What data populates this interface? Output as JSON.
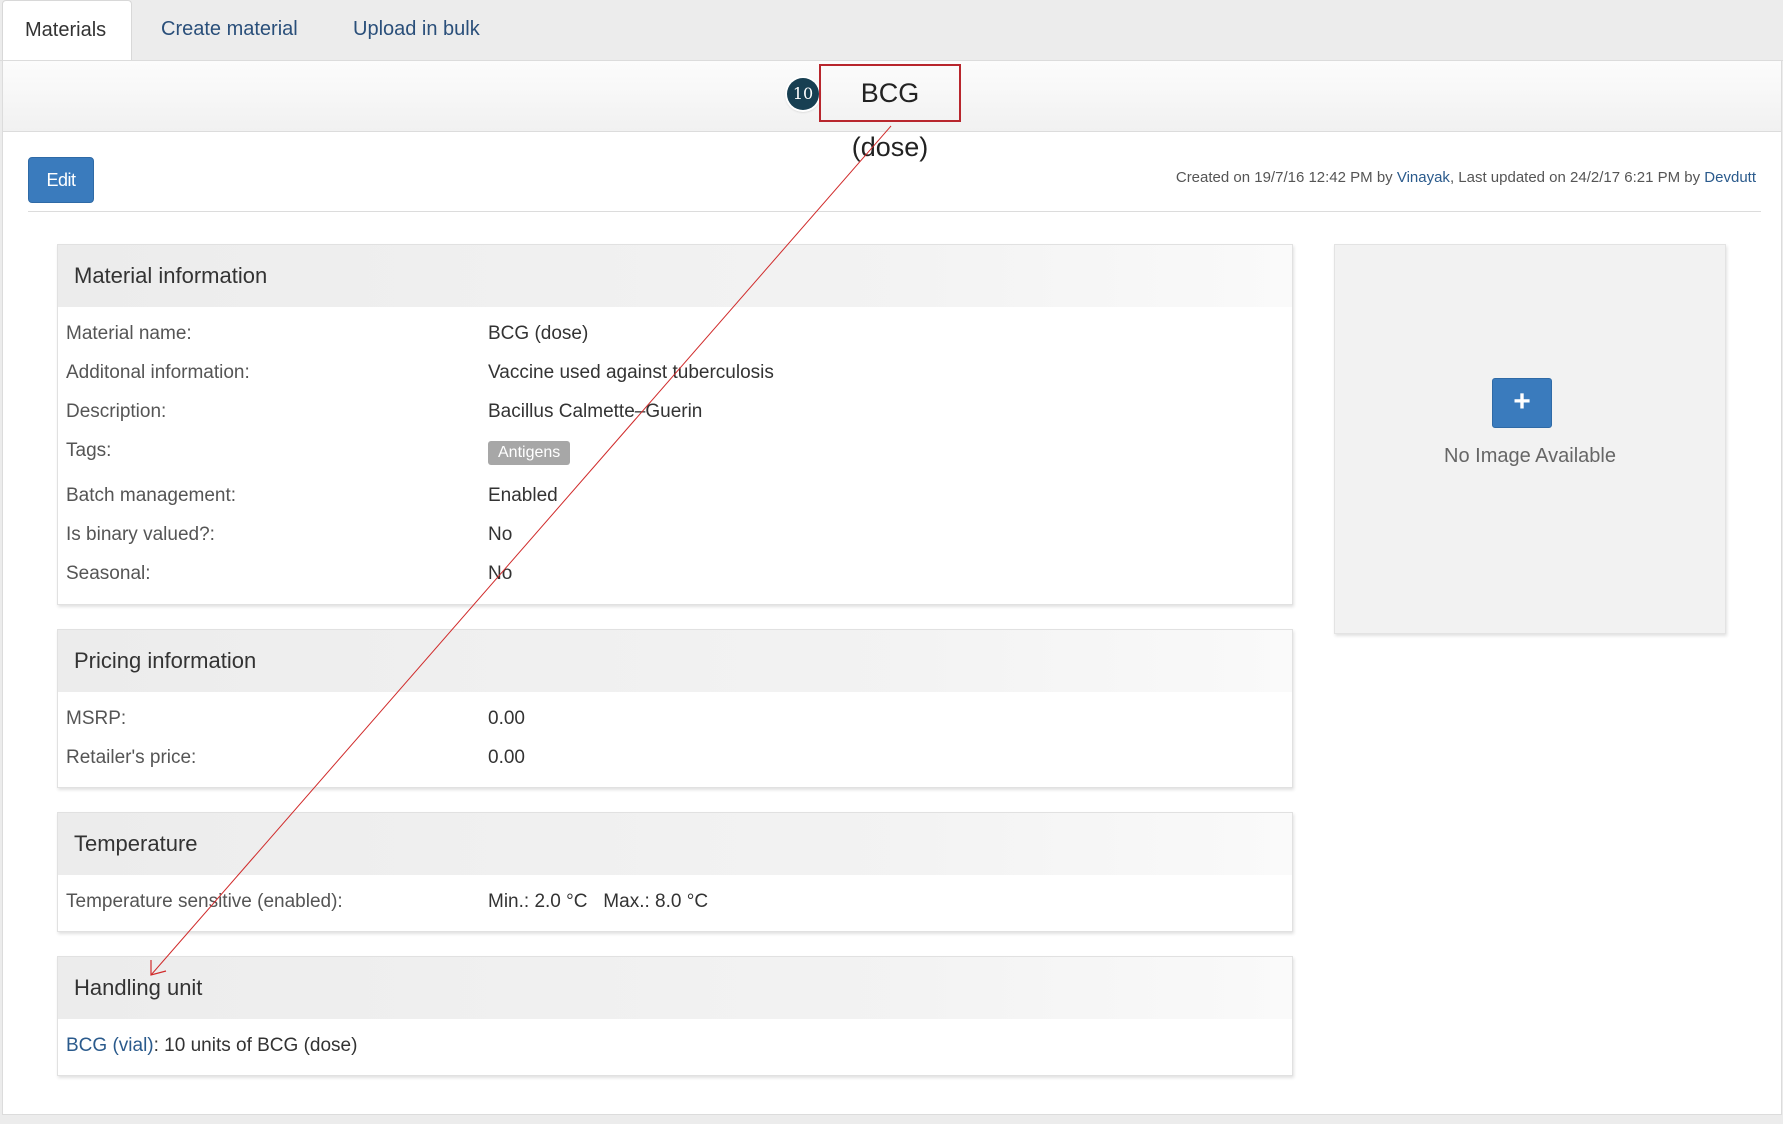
{
  "tabs": [
    {
      "label": "Materials",
      "active": true
    },
    {
      "label": "Create material",
      "active": false
    },
    {
      "label": "Upload in bulk",
      "active": false
    }
  ],
  "header": {
    "title": "BCG (dose)",
    "step_number": "10"
  },
  "toolbar": {
    "edit_label": "Edit"
  },
  "meta": {
    "created_prefix": "Created on 19/7/16 12:42 PM by ",
    "created_by": "Vinayak",
    "updated_prefix": ", Last updated on 24/2/17 6:21 PM by ",
    "updated_by": "Devdutt"
  },
  "material_info": {
    "heading": "Material information",
    "rows": [
      {
        "label": "Material name:",
        "value": "BCG (dose)"
      },
      {
        "label": "Additonal information:",
        "value": "Vaccine used against tuberculosis"
      },
      {
        "label": "Description:",
        "value": "Bacillus Calmette–Guerin"
      },
      {
        "label": "Tags:",
        "value": "Antigens"
      },
      {
        "label": "Batch management:",
        "value": "Enabled"
      },
      {
        "label": "Is binary valued?:",
        "value": "No"
      },
      {
        "label": "Seasonal:",
        "value": "No"
      }
    ]
  },
  "pricing": {
    "heading": "Pricing information",
    "rows": [
      {
        "label": "MSRP:",
        "value": "0.00"
      },
      {
        "label": "Retailer's price:",
        "value": "0.00"
      }
    ]
  },
  "temperature": {
    "heading": "Temperature",
    "label": "Temperature sensitive (enabled):",
    "value": "Min.: 2.0 °C   Max.: 8.0 °C"
  },
  "handling": {
    "heading": "Handling unit",
    "link": "BCG (vial)",
    "text": ": 10 units of BCG (dose)"
  },
  "image": {
    "add_label": "+",
    "empty_text": "No Image Available"
  },
  "colors": {
    "accent": "#3a7bbd",
    "link": "#2a5a8c",
    "annotation": "#b8262d",
    "badge": "#173f52"
  }
}
